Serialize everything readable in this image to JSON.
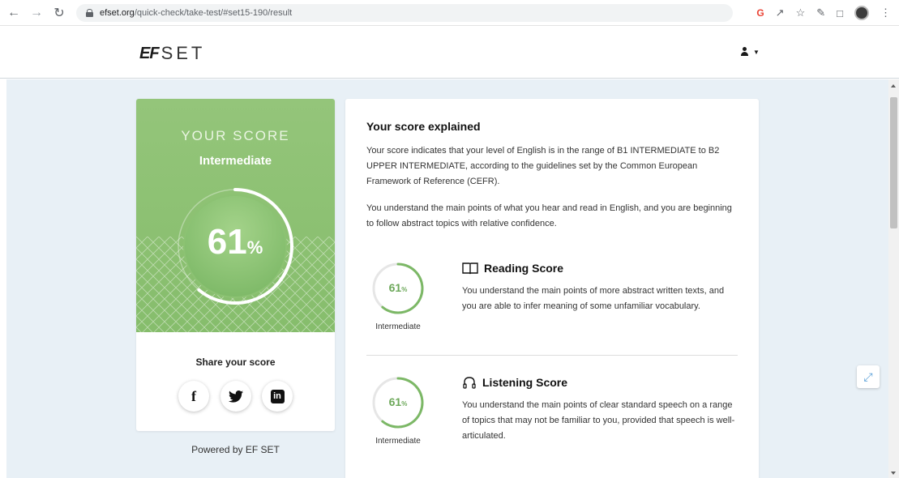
{
  "browser": {
    "url_host": "efset.org",
    "url_path": "/quick-check/take-test/#set15-190/result",
    "back_icon": "arrow-left-icon",
    "forward_icon": "arrow-right-icon",
    "reload_icon": "reload-icon"
  },
  "header": {
    "logo_ef": "EF",
    "logo_set": "SET"
  },
  "score_card": {
    "heading": "YOUR SCORE",
    "level": "Intermediate",
    "score_value": "61",
    "score_unit": "%",
    "score_fraction": 0.61,
    "share_title": "Share your score",
    "social": [
      "facebook-icon",
      "twitter-icon",
      "linkedin-icon"
    ]
  },
  "powered_by": "Powered by EF SET",
  "explanation": {
    "title": "Your score explained",
    "paragraph_1": "Your score indicates that your level of English is in the range of B1 INTERMEDIATE to B2 UPPER INTERMEDIATE, according to the guidelines set by the Common European Framework of Reference (CEFR).",
    "paragraph_2": "You understand the main points of what you hear and read in English, and you are beginning to follow abstract topics with relative confidence.",
    "reading": {
      "title": "Reading Score",
      "score_value": "61",
      "score_unit": "%",
      "score_fraction": 0.61,
      "level": "Intermediate",
      "description": "You understand the main points of more abstract written texts, and you are able to infer meaning of some unfamiliar vocabulary."
    },
    "listening": {
      "title": "Listening Score",
      "score_value": "61",
      "score_unit": "%",
      "score_fraction": 0.61,
      "level": "Intermediate",
      "description": "You understand the main points of clear standard speech on a range of topics that may not be familiar to you, provided that speech is well-articulated."
    }
  },
  "colors": {
    "accent_green": "#7cb866",
    "page_background": "#e8f0f6"
  }
}
